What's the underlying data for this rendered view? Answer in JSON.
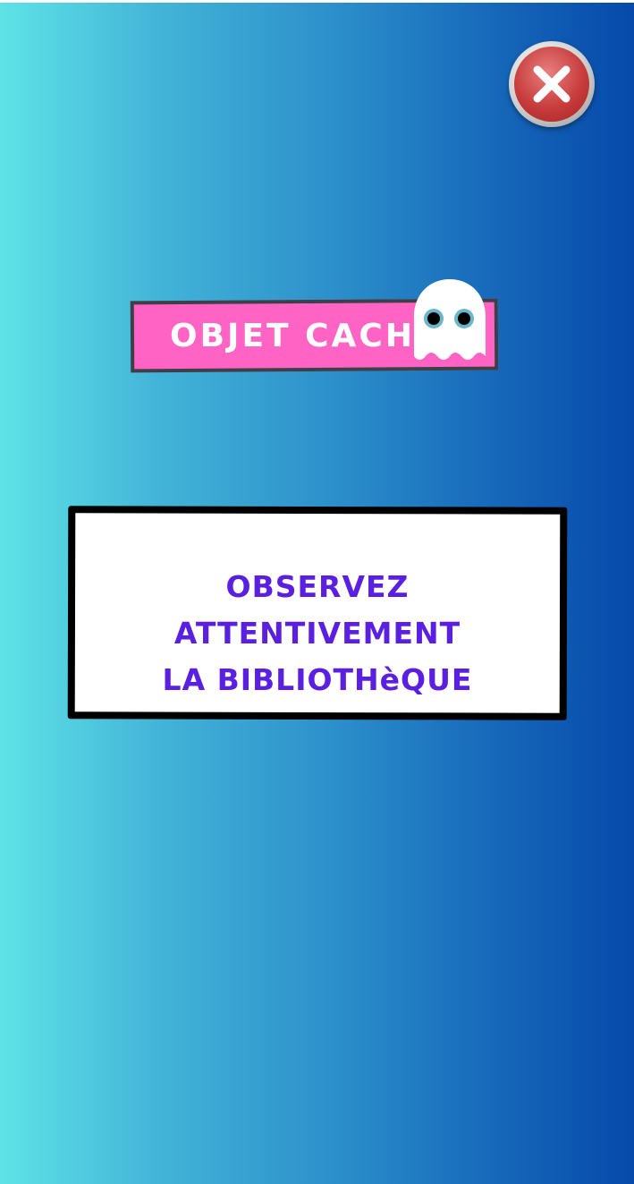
{
  "window": {
    "title_banner": "OBJET CACHÉ",
    "close_label": "close"
  },
  "instruction": {
    "line1": "OBSERVEZ ATTENTIVEMENT",
    "line2": "LA BIBLIOTHèQUE"
  },
  "icons": {
    "close": "close-x-icon",
    "mascot": "ghost-icon"
  },
  "colors": {
    "gradient_left": "#5ee3e6",
    "gradient_right": "#0649aa",
    "banner_pink": "#ff63c4",
    "banner_border": "#3b4148",
    "instruction_text": "#5a1fe0",
    "close_red": "#c83c3c"
  }
}
